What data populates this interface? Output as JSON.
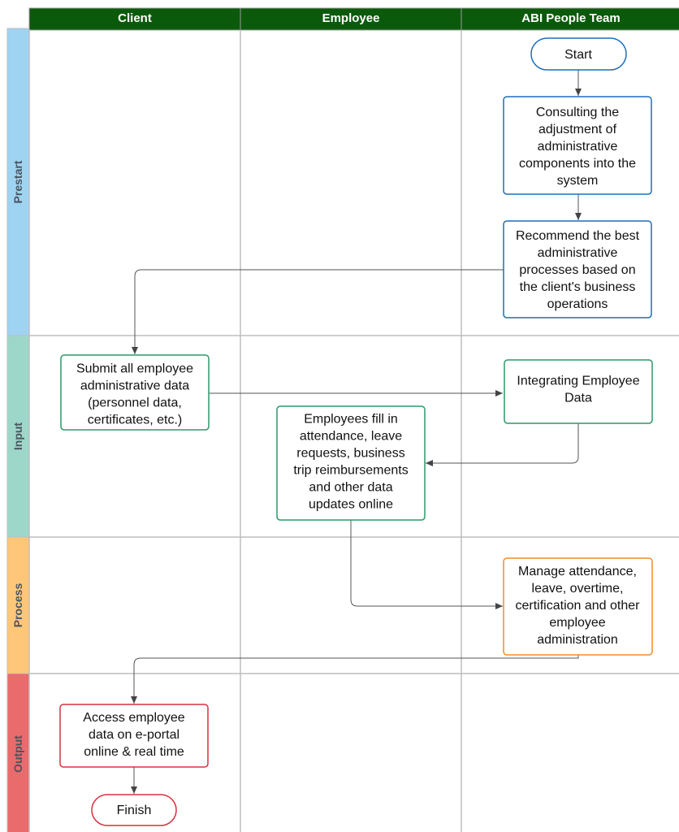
{
  "columns": [
    "Client",
    "Employee",
    "ABI People Team"
  ],
  "lanes": [
    {
      "label": "Prestart",
      "color": "#9fd3f2"
    },
    {
      "label": "Input",
      "color": "#9dd7c9"
    },
    {
      "label": "Process",
      "color": "#fec678"
    },
    {
      "label": "Output",
      "color": "#ea6b6b"
    }
  ],
  "colors": {
    "header": "#0b5a0b",
    "prestart_border": "#1a6fbf",
    "input_border": "#2a9a6a",
    "process_border": "#f58b2a",
    "output_border": "#d9303f"
  },
  "nodes": {
    "start": {
      "lines": [
        "Start"
      ]
    },
    "consult": {
      "lines": [
        "Consulting the",
        "adjustment of",
        "administrative",
        "components into the",
        "system"
      ]
    },
    "recommend": {
      "lines": [
        "Recommend the best",
        "administrative",
        "processes based on",
        "the client's business",
        "operations"
      ]
    },
    "submit": {
      "lines": [
        "Submit all employee",
        "administrative data",
        "(personnel data,",
        "certificates, etc.)"
      ]
    },
    "integrate": {
      "lines": [
        "Integrating Employee",
        "Data"
      ]
    },
    "fill": {
      "lines": [
        "Employees fill in",
        "attendance, leave",
        "requests, business",
        "trip reimbursements",
        "and other data",
        "updates online"
      ]
    },
    "manage": {
      "lines": [
        "Manage attendance,",
        "leave, overtime,",
        "certification and other",
        "employee",
        "administration"
      ]
    },
    "access": {
      "lines": [
        "Access employee",
        "data on e-portal",
        "online & real time"
      ]
    },
    "finish": {
      "lines": [
        "Finish"
      ]
    }
  }
}
